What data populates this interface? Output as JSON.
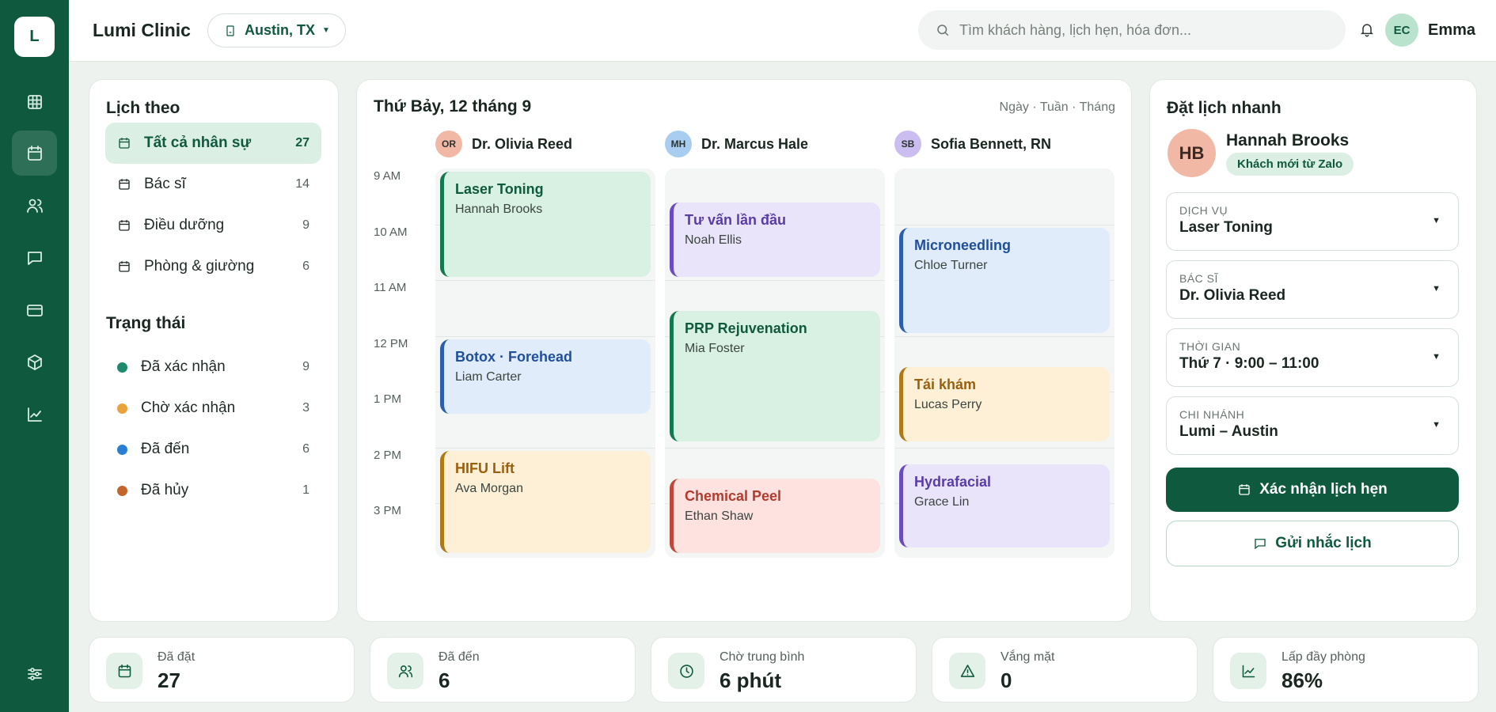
{
  "app": {
    "logo": "L",
    "title": "Lumi Clinic",
    "branch": "Austin, TX"
  },
  "search": {
    "placeholder": "Tìm khách hàng, lịch hẹn, hóa đơn..."
  },
  "user": {
    "initials": "EC",
    "name": "Emma"
  },
  "rail": {
    "items": [
      "grid-icon",
      "calendar-icon",
      "users-icon",
      "message-icon",
      "card-icon",
      "box-icon",
      "chart-icon"
    ],
    "active": "calendar-icon",
    "bottom": "sliders-icon"
  },
  "filters": {
    "title": "Lịch theo",
    "items": [
      {
        "label": "Tất cả nhân sự",
        "count": "27"
      },
      {
        "label": "Bác sĩ",
        "count": "14"
      },
      {
        "label": "Điều dưỡng",
        "count": "9"
      },
      {
        "label": "Phòng & giường",
        "count": "6"
      }
    ]
  },
  "status": {
    "title": "Trạng thái",
    "items": [
      {
        "label": "Đã xác nhận",
        "count": "9",
        "color": "#1e8a6e"
      },
      {
        "label": "Chờ xác nhận",
        "count": "3",
        "color": "#e8a33d"
      },
      {
        "label": "Đã đến",
        "count": "6",
        "color": "#2a7fd4"
      },
      {
        "label": "Đã hủy",
        "count": "1",
        "color": "#c2652f"
      }
    ]
  },
  "calendar": {
    "date": "Thứ Bảy, 12 tháng 9",
    "views": "Ngày · Tuần · Tháng",
    "times": [
      "9 AM",
      "10 AM",
      "11 AM",
      "12 PM",
      "1 PM",
      "2 PM",
      "3 PM"
    ],
    "columns": [
      {
        "initials": "OR",
        "name": "Dr. Olivia Reed",
        "badge_color": "#f2b8a6",
        "appointments": [
          {
            "title": "Laser Toning",
            "client": "Hannah Brooks",
            "start": 9.0,
            "end": 10.95,
            "color": "green"
          },
          {
            "title": "Botox · Forehead",
            "client": "Liam Carter",
            "start": 12.0,
            "end": 13.4,
            "color": "blue"
          },
          {
            "title": "HIFU Lift",
            "client": "Ava Morgan",
            "start": 14.0,
            "end": 15.9,
            "color": "amber"
          }
        ]
      },
      {
        "initials": "MH",
        "name": "Dr. Marcus Hale",
        "badge_color": "#a9cdf0",
        "appointments": [
          {
            "title": "Tư vấn lần đầu",
            "client": "Noah Ellis",
            "start": 9.55,
            "end": 10.95,
            "color": "purple"
          },
          {
            "title": "PRP Rejuvenation",
            "client": "Mia Foster",
            "start": 11.5,
            "end": 13.9,
            "color": "green"
          },
          {
            "title": "Chemical Peel",
            "client": "Ethan Shaw",
            "start": 14.5,
            "end": 15.9,
            "color": "red"
          }
        ]
      },
      {
        "initials": "SB",
        "name": "Sofia Bennett, RN",
        "badge_color": "#cbbdf0",
        "appointments": [
          {
            "title": "Microneedling",
            "client": "Chloe Turner",
            "start": 10.0,
            "end": 11.95,
            "color": "blue"
          },
          {
            "title": "Tái khám",
            "client": "Lucas Perry",
            "start": 12.5,
            "end": 13.9,
            "color": "amber"
          },
          {
            "title": "Hydrafacial",
            "client": "Grace Lin",
            "start": 14.25,
            "end": 15.8,
            "color": "purple"
          }
        ]
      }
    ],
    "palette": {
      "green": {
        "bg": "#d9f1e3",
        "border": "#137a50",
        "text": "#0f5a3f"
      },
      "blue": {
        "bg": "#e1ecfa",
        "border": "#2a5fb0",
        "text": "#1f4f9c"
      },
      "amber": {
        "bg": "#fdf0d6",
        "border": "#b07915",
        "text": "#9a5f0c"
      },
      "purple": {
        "bg": "#e9e4fa",
        "border": "#6b4bc2",
        "text": "#5a3ca8"
      },
      "red": {
        "bg": "#fde2df",
        "border": "#c0473a",
        "text": "#b23a2e"
      }
    }
  },
  "quick": {
    "title": "Đặt lịch nhanh",
    "patient": {
      "initials": "HB",
      "name": "Hannah Brooks",
      "tag": "Khách mới từ Zalo"
    },
    "fields": [
      {
        "label": "DỊCH VỤ",
        "value": "Laser Toning"
      },
      {
        "label": "BÁC SĨ",
        "value": "Dr. Olivia Reed"
      },
      {
        "label": "THỜI GIAN",
        "value": "Thứ 7 · 9:00 – 11:00"
      },
      {
        "label": "CHI NHÁNH",
        "value": "Lumi – Austin"
      }
    ],
    "confirm": "Xác nhận lịch hẹn",
    "remind": "Gửi nhắc lịch"
  },
  "stats": [
    {
      "label": "Đã đặt",
      "value": "27",
      "icon": "calendar-icon"
    },
    {
      "label": "Đã đến",
      "value": "6",
      "icon": "users-icon"
    },
    {
      "label": "Chờ trung bình",
      "value": "6 phút",
      "icon": "clock-icon"
    },
    {
      "label": "Vắng mặt",
      "value": "0",
      "icon": "alert-icon"
    },
    {
      "label": "Lấp đầy phòng",
      "value": "86%",
      "icon": "chart-icon"
    }
  ]
}
